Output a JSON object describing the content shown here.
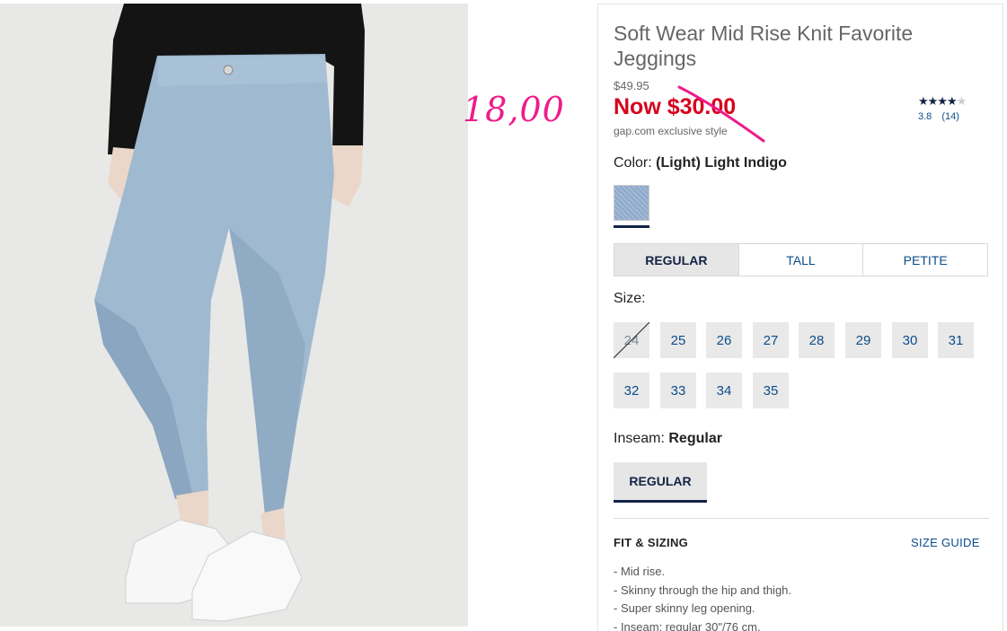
{
  "product": {
    "title": "Soft Wear Mid Rise Knit Favorite Jeggings",
    "original_price": "$49.95",
    "sale_price": "Now $30.00",
    "exclusive_note": "gap.com exclusive style",
    "rating": {
      "stars_full": "★★★★",
      "stars_empty": "★",
      "score": "3.8",
      "count": "(14)"
    }
  },
  "annotation": {
    "handwritten_price": "18,00",
    "color": "#ee1b8a"
  },
  "color": {
    "label": "Color:",
    "value": "(Light) Light Indigo",
    "swatch_color": "#9db4d2"
  },
  "fit_tabs": [
    {
      "label": "REGULAR",
      "active": true
    },
    {
      "label": "TALL",
      "active": false
    },
    {
      "label": "PETITE",
      "active": false
    }
  ],
  "sizes": {
    "label": "Size:",
    "options": [
      {
        "label": "24",
        "available": false
      },
      {
        "label": "25",
        "available": true
      },
      {
        "label": "26",
        "available": true
      },
      {
        "label": "27",
        "available": true
      },
      {
        "label": "28",
        "available": true
      },
      {
        "label": "29",
        "available": true
      },
      {
        "label": "30",
        "available": true
      },
      {
        "label": "31",
        "available": true
      },
      {
        "label": "32",
        "available": true
      },
      {
        "label": "33",
        "available": true
      },
      {
        "label": "34",
        "available": true
      },
      {
        "label": "35",
        "available": true
      }
    ]
  },
  "inseam": {
    "label": "Inseam:",
    "value": "Regular",
    "button_label": "REGULAR"
  },
  "fit_sizing": {
    "heading": "FIT & SIZING",
    "size_guide_link": "SIZE GUIDE",
    "bullets": [
      "- Mid rise.",
      "- Skinny through the hip and thigh.",
      "- Super skinny leg opening.",
      "- Inseam: regular 30\"/76 cm."
    ]
  },
  "colors": {
    "sale_red": "#d6001c",
    "link_blue": "#0b4d8c",
    "navy": "#122344"
  }
}
